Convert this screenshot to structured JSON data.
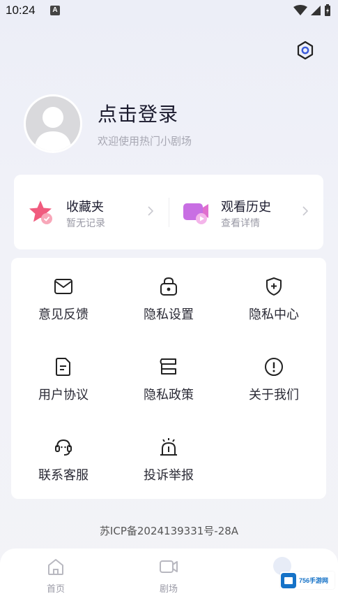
{
  "status_bar": {
    "time": "10:24",
    "notification": "A"
  },
  "profile": {
    "title": "点击登录",
    "subtitle": "欢迎使用热门小剧场"
  },
  "quick": [
    {
      "title": "收藏夹",
      "subtitle": "暂无记录",
      "icon": "star-favorite-icon"
    },
    {
      "title": "观看历史",
      "subtitle": "查看详情",
      "icon": "video-history-icon"
    }
  ],
  "menu": [
    {
      "label": "意见反馈",
      "icon": "envelope-icon"
    },
    {
      "label": "隐私设置",
      "icon": "lock-icon"
    },
    {
      "label": "隐私中心",
      "icon": "shield-plus-icon"
    },
    {
      "label": "用户协议",
      "icon": "document-icon"
    },
    {
      "label": "隐私政策",
      "icon": "scroll-icon"
    },
    {
      "label": "关于我们",
      "icon": "info-exclamation-icon"
    },
    {
      "label": "联系客服",
      "icon": "headset-icon"
    },
    {
      "label": "投诉举报",
      "icon": "alarm-icon"
    }
  ],
  "icp": "苏ICP备2024139331号-28A",
  "bottom_nav": [
    {
      "label": "首页",
      "icon": "home-icon"
    },
    {
      "label": "剧场",
      "icon": "video-camera-icon"
    }
  ],
  "watermark": {
    "text": "756手游网"
  },
  "colors": {
    "accent_settings": "#3b5bdb",
    "favorite_star": "#f05b7e",
    "history_camera": "#c86ee3",
    "text_primary": "#1b1b2e",
    "text_secondary": "#9a9aa6"
  }
}
